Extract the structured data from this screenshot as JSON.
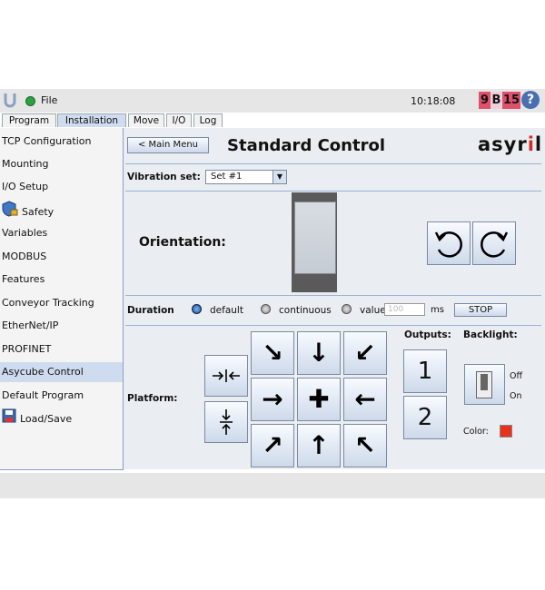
{
  "topbar": {
    "file_label": "File",
    "clock": "10:18:08",
    "badge_chars": [
      "9",
      "B",
      "15"
    ],
    "help_label": "?",
    "colors": {
      "status_dot": "#2ea043",
      "badge": "#e0506a",
      "help": "#4a6fb0"
    }
  },
  "tabs": [
    {
      "label": "Program",
      "active": false
    },
    {
      "label": "Installation",
      "active": true
    },
    {
      "label": "Move",
      "active": false
    },
    {
      "label": "I/O",
      "active": false
    },
    {
      "label": "Log",
      "active": false
    }
  ],
  "sidebar": {
    "items": [
      {
        "label": "TCP Configuration"
      },
      {
        "label": "Mounting"
      },
      {
        "label": "I/O Setup"
      },
      {
        "label": "Safety",
        "icon": "shield-lock-icon"
      },
      {
        "label": "Variables"
      },
      {
        "label": "MODBUS"
      },
      {
        "label": "Features"
      },
      {
        "label": "Conveyor Tracking"
      },
      {
        "label": "EtherNet/IP"
      },
      {
        "label": "PROFINET"
      },
      {
        "label": "Asycube Control",
        "selected": true
      },
      {
        "label": "Default Program"
      },
      {
        "label": "Load/Save",
        "icon": "floppy-disk-icon"
      }
    ]
  },
  "main": {
    "main_menu_label": "< Main Menu",
    "title": "Standard Control",
    "brand_left": "asyr",
    "brand_i": "i",
    "brand_right": "l",
    "vibration_label": "Vibration set:",
    "vibration_value": "Set #1",
    "orientation_label": "Orientation:",
    "duration": {
      "label": "Duration",
      "options": [
        "default",
        "continuous",
        "value"
      ],
      "selected": "default",
      "value_placeholder": "100",
      "unit": "ms",
      "stop_label": "STOP"
    },
    "platform_label": "Platform:",
    "outputs_label": "Outputs:",
    "output_buttons": [
      "1",
      "2"
    ],
    "backlight_label": "Backlight:",
    "off_label": "Off",
    "on_label": "On",
    "color_label": "Color:",
    "backlight_color": "#e8301c",
    "platform_arrows": [
      "↘",
      "↓",
      "↙",
      "→",
      "✚",
      "←",
      "↗",
      "↑",
      "↖"
    ]
  }
}
